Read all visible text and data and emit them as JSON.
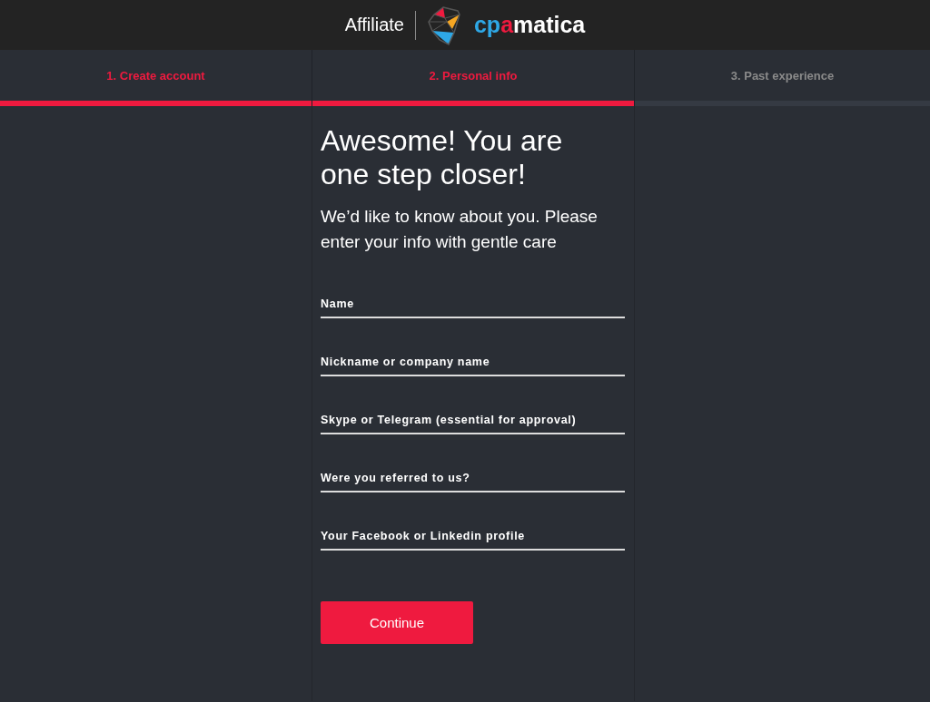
{
  "header": {
    "label": "Affiliate",
    "logo_parts": [
      {
        "text": "cp",
        "color": "#2ea8e6"
      },
      {
        "text": "a",
        "color": "#ef1a3f"
      },
      {
        "text": "matica",
        "color": "#ffffff"
      }
    ]
  },
  "steps": [
    {
      "label": "1. Create account",
      "done": true
    },
    {
      "label": "2. Personal info",
      "done": true
    },
    {
      "label": "3. Past experience",
      "done": false
    }
  ],
  "form": {
    "title": "Awesome! You are one step closer!",
    "subtitle": "We’d like to know about you. Please enter your info with gentle care",
    "fields": [
      {
        "placeholder": "Name"
      },
      {
        "placeholder": "Nickname or company name"
      },
      {
        "placeholder": "Skype or Telegram (essential for approval)"
      },
      {
        "placeholder": "Were you referred to us?"
      },
      {
        "placeholder": "Your Facebook or Linkedin profile"
      }
    ],
    "button": "Continue"
  }
}
